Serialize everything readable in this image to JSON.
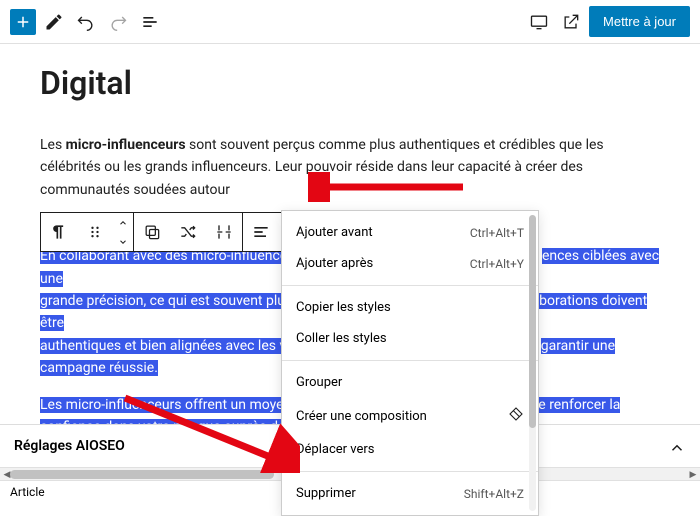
{
  "topbar": {
    "update_label": "Mettre à jour"
  },
  "post": {
    "title": "Digital",
    "p1_prefix": "Les ",
    "p1_bold": "micro-influenceurs",
    "p1_rest": " sont souvent perçus comme plus authentiques et crédibles que les célébrités ou les grands influenceurs. Leur pouvoir réside dans leur capacité à créer des communautés soudées autour",
    "p2_a": "En collaborant avec des micro-influenceu",
    "p2_b": "ences ciblées avec une",
    "p2_c": "grande précision, ce qui est souvent plus",
    "p2_d": "borations doivent être",
    "p2_e": "authentiques et bien alignées avec les va",
    "p2_f": "garantir une",
    "p2_g": "campagne réussie.",
    "p3_a": "Les micro-influenceurs offrent un moyen",
    "p3_b": "e renforcer la",
    "p3_c": "confiance dans votre marque auprès de"
  },
  "menu": {
    "insert_before": "Ajouter avant",
    "insert_before_sc": "Ctrl+Alt+T",
    "insert_after": "Ajouter après",
    "insert_after_sc": "Ctrl+Alt+Y",
    "copy_styles": "Copier les styles",
    "paste_styles": "Coller les styles",
    "group": "Grouper",
    "create_comp": "Créer une composition",
    "move_to": "Déplacer vers",
    "delete": "Supprimer",
    "delete_sc": "Shift+Alt+Z"
  },
  "panel": {
    "title": "Réglages AIOSEO"
  },
  "breadcrumb": {
    "root": "Article"
  }
}
